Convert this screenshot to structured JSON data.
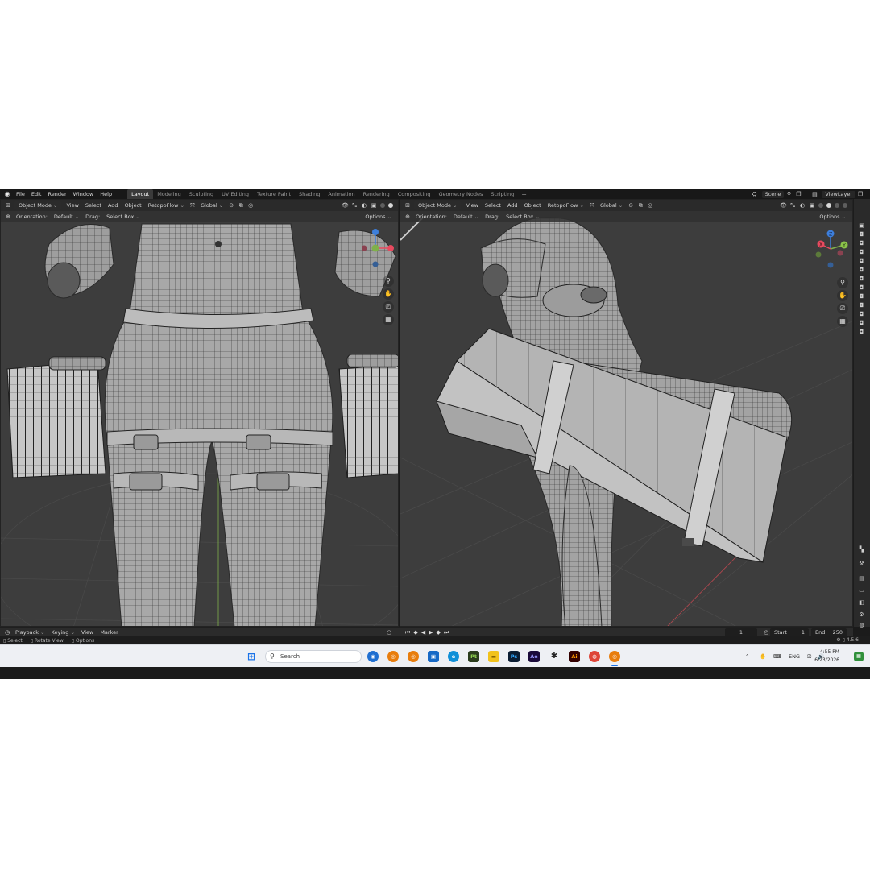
{
  "menu": [
    "File",
    "Edit",
    "Render",
    "Window",
    "Help"
  ],
  "workspaces": [
    "Layout",
    "Modeling",
    "Sculpting",
    "UV Editing",
    "Texture Paint",
    "Shading",
    "Animation",
    "Rendering",
    "Compositing",
    "Geometry Nodes",
    "Scripting"
  ],
  "active_workspace": "Layout",
  "scene": "Scene",
  "view_layer": "ViewLayer",
  "viewport_left": {
    "mode": "Object Mode",
    "menus": [
      "View",
      "Select",
      "Add",
      "Object",
      "RetopoFlow"
    ],
    "transform_space": "Global",
    "orientation_label": "Orientation:",
    "orientation_value": "Default",
    "drag_label": "Drag:",
    "drag_value": "Select Box",
    "options": "Options"
  },
  "viewport_right": {
    "mode": "Object Mode",
    "menus": [
      "View",
      "Select",
      "Add",
      "Object",
      "RetopoFlow"
    ],
    "transform_space": "Global",
    "orientation_label": "Orientation:",
    "orientation_value": "Default",
    "drag_label": "Drag:",
    "drag_value": "Select Box",
    "options": "Options",
    "gizmo_axes": [
      "Z",
      "X",
      "Y"
    ]
  },
  "timeline": {
    "menus": [
      "Playback",
      "Keying",
      "View",
      "Marker"
    ],
    "current_frame": "1",
    "start_label": "Start",
    "start_value": "1",
    "end_label": "End",
    "end_value": "250"
  },
  "statusbar": {
    "items": [
      "Select",
      "Rotate View",
      "Options"
    ],
    "version": "4.5.6"
  },
  "taskbar": {
    "search_placeholder": "Search",
    "apps": [
      "Pt",
      "Ps",
      "Ae",
      "Ai"
    ],
    "language": "ENG",
    "time": "4:55 PM",
    "date": "6/23/2026"
  },
  "colors": {
    "viewport_bg": "#3d3d3d",
    "mesh_fill": "#a9a9a9",
    "wire": "#2b2b2b",
    "axis_x": "#e84a5f",
    "axis_y": "#8bc34a",
    "axis_z": "#3d7fdc"
  }
}
